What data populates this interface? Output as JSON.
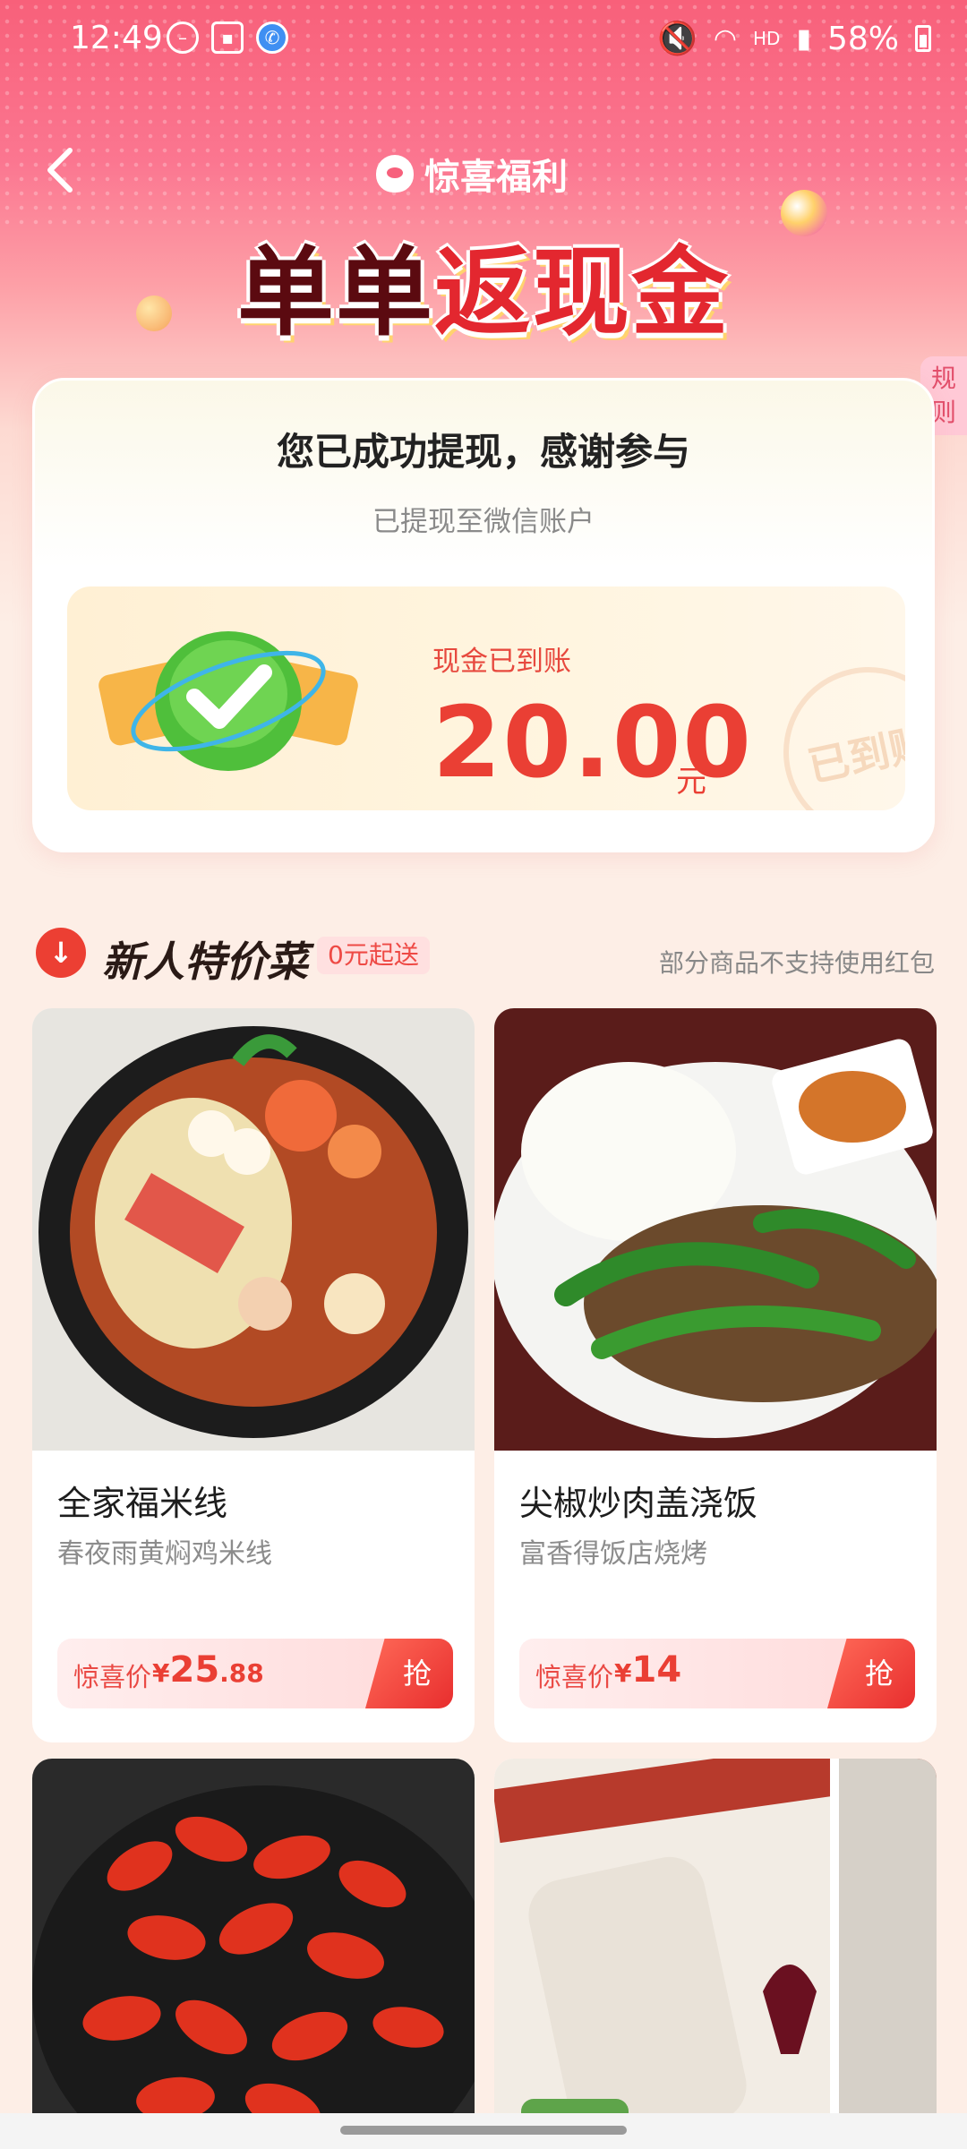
{
  "status_bar": {
    "time": "12:49",
    "battery": "58%",
    "network": "HD"
  },
  "header": {
    "brand_title": "惊喜福利",
    "headline_part1": "单单",
    "headline_part2": "返现金",
    "rules_label": "规则"
  },
  "card": {
    "title": "您已成功提现，感谢参与",
    "subtitle": "已提现至微信账户",
    "cash_label": "现金已到账",
    "amount": "20.00",
    "unit": "元",
    "stamp": "已到账"
  },
  "section": {
    "title": "新人特价菜",
    "badge": "0元起送",
    "note": "部分商品不支持使用红包"
  },
  "products": [
    {
      "name": "全家福米线",
      "shop": "春夜雨黄焖鸡米线",
      "price_label": "惊喜价",
      "currency": "¥",
      "price_int": "25",
      "price_dec": ".88",
      "button": "抢"
    },
    {
      "name": "尖椒炒肉盖浇饭",
      "shop": "富香得饭店烧烤",
      "price_label": "惊喜价",
      "currency": "¥",
      "price_int": "14",
      "price_dec": "",
      "button": "抢"
    }
  ],
  "colors": {
    "accent": "#ea3f34",
    "hero_pink": "#f8607a",
    "page_bg": "#fdeee6"
  }
}
